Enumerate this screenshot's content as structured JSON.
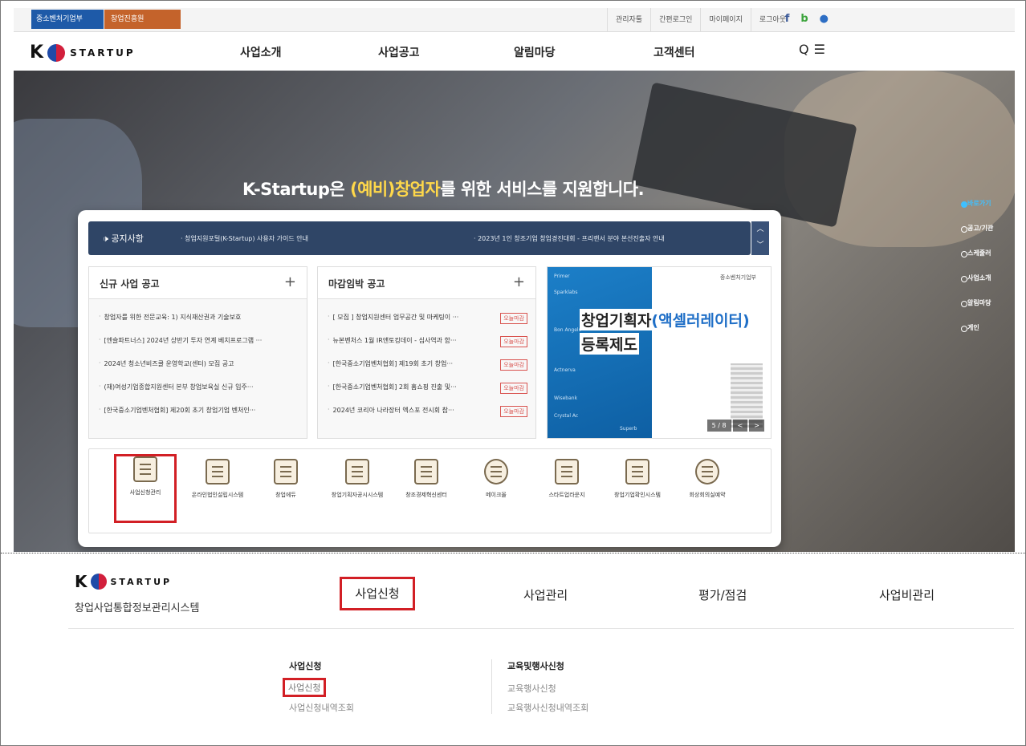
{
  "util": {
    "badge1": "중소벤처기업부",
    "badge2": "창업진흥원",
    "links": [
      "관리자툴",
      "간편로그인",
      "마이페이지",
      "로그아웃"
    ],
    "sns": [
      "f",
      "b",
      "●"
    ]
  },
  "nav": {
    "logo_k": "K",
    "logo_text": "STARTUP",
    "menu": [
      "사업소개",
      "사업공고",
      "알림마당",
      "고객센터"
    ],
    "search_icon": "Q",
    "menu_icon": "☰"
  },
  "hero": {
    "title_pre": "K-Startup은 ",
    "title_hl": "(예비)창업자",
    "title_post": "를 위한 서비스를 지원합니다."
  },
  "notice": {
    "label": "공지사항",
    "items": [
      "· 창업지원포털(K-Startup) 사용자 가이드 안내",
      "· 2023년 1인 창조기업 창업경진대회 - 프리랜서 분야 본선진출자 안내"
    ]
  },
  "new_box": {
    "title": "신규 사업 공고",
    "plus": "+",
    "items": [
      "창업자를 위한 전문교육: 1) 지식재산권과 기술보호",
      "[엔슬파트너스] 2024년 상반기 투자 연계 베치프로그램 ···",
      "2024년 청소년비즈쿨 운영학교(센터) 모집 공고",
      "(재)여성기업종합지원센터 본부 창업보육실 신규 입주···",
      "[한국중소기업벤처협회] 제20회 초기 창업기업 벤처인···"
    ]
  },
  "deadline_box": {
    "title": "마감임박 공고",
    "plus": "+",
    "tag": "오늘마감",
    "items": [
      "[ 모집 ] 창업지원센터 업무공간 및 마케팅이 ···",
      "뉴본벤처스 1월 IR앤토킹데이 - 심사역과 함···",
      "[한국중소기업벤처협회] 제19회 초기 창업···",
      "[한국중소기업벤처협회] 2회 홈쇼핑 진출 및···",
      "2024년 코리아 나라장터 엑스포 전시회 참···"
    ]
  },
  "banner": {
    "title1_pre": "창업기획자",
    "title1_hl": "(액셀러레이터)",
    "title2": "등록제도",
    "corp": "중소벤처기업부",
    "partners": [
      "Primer",
      "Sparklabs",
      "Bon Angels",
      "Actnerva",
      "Wisebank",
      "Crystal Ac",
      "Superb"
    ],
    "page": "5 / 8",
    "prev": "<",
    "next": ">"
  },
  "services": [
    {
      "label": "사업신청관리",
      "icon": "clipboard-icon",
      "selected": true
    },
    {
      "label": "온라인법인설립시스템",
      "icon": "document-icon"
    },
    {
      "label": "창업에듀",
      "icon": "book-icon"
    },
    {
      "label": "창업기획자공시시스템",
      "icon": "board-icon"
    },
    {
      "label": "창조경제혁신센터",
      "icon": "building-icon"
    },
    {
      "label": "메이크올",
      "icon": "gear-icon"
    },
    {
      "label": "스타트업라운지",
      "icon": "people-icon"
    },
    {
      "label": "창업기업확인시스템",
      "icon": "certificate-icon"
    },
    {
      "label": "회상회의실예약",
      "icon": "meeting-icon"
    }
  ],
  "side_menu": [
    "바로가기",
    "공고/기관",
    "스케줄러",
    "사업소개",
    "알림마당",
    "게인"
  ],
  "system": {
    "logo_k": "K",
    "logo_text": "STARTUP",
    "name": "창업사업통합정보관리시스템",
    "menu": [
      "사업신청",
      "사업관리",
      "평가/점검",
      "사업비관리"
    ]
  },
  "submenu": {
    "col1_head": "사업신청",
    "col1_items": [
      "사업신청",
      "사업신청내역조회"
    ],
    "col2_head": "교육및행사신청",
    "col2_items": [
      "교육행사신청",
      "교육행사신청내역조회"
    ]
  },
  "colors": {
    "nav_dark": "#2f4566",
    "highlight_red": "#d21f25",
    "accent_yellow": "#ffd84a",
    "tag_red": "#d9534f"
  }
}
